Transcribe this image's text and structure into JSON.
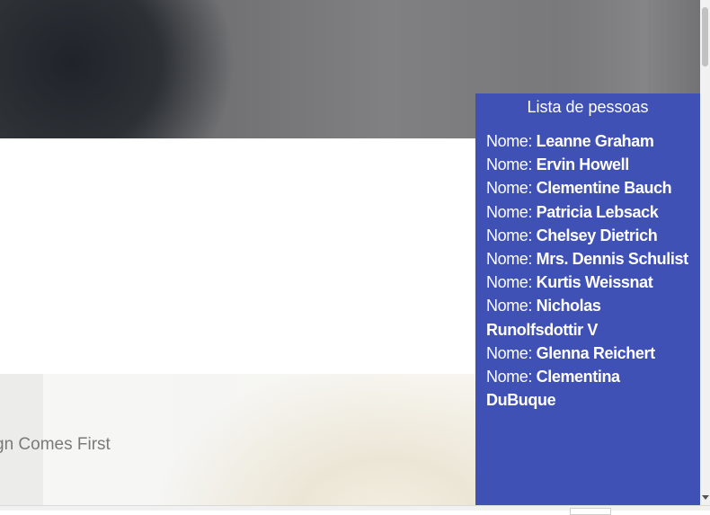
{
  "hero": {
    "tagline": "gn Comes First"
  },
  "panel": {
    "title": "Lista de pessoas",
    "label_prefix": "Nome:",
    "people": [
      "Leanne Graham",
      "Ervin Howell",
      "Clementine Bauch",
      "Patricia Lebsack",
      "Chelsey Dietrich",
      "Mrs. Dennis Schulist",
      "Kurtis Weissnat",
      "Nicholas Runolfsdottir V",
      "Glenna Reichert",
      "Clementina DuBuque"
    ]
  },
  "colors": {
    "panel_background": "#3f51b5",
    "panel_text": "#ffffff",
    "tagline_text": "#7a7a7a"
  }
}
